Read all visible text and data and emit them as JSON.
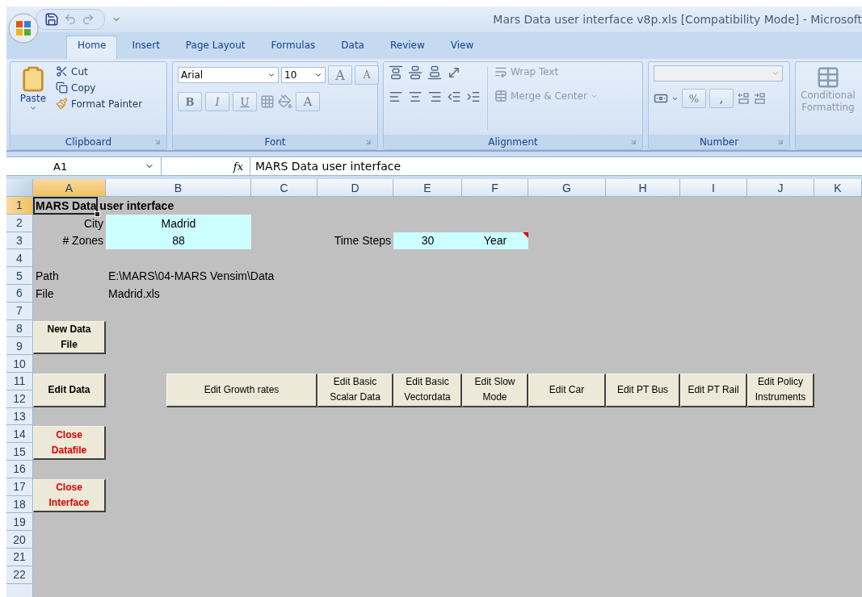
{
  "window": {
    "title": "Mars Data user interface v8p.xls  [Compatibility Mode] - Microsoft"
  },
  "ribbon_tabs": [
    {
      "label": "Home",
      "selected": true
    },
    {
      "label": "Insert",
      "selected": false
    },
    {
      "label": "Page Layout",
      "selected": false
    },
    {
      "label": "Formulas",
      "selected": false
    },
    {
      "label": "Data",
      "selected": false
    },
    {
      "label": "Review",
      "selected": false
    },
    {
      "label": "View",
      "selected": false
    }
  ],
  "clipboard": {
    "title": "Clipboard",
    "paste": "Paste",
    "cut": "Cut",
    "copy": "Copy",
    "format_painter": "Format Painter"
  },
  "font": {
    "title": "Font",
    "font_name": "Arial",
    "font_size": "10",
    "grow": "A",
    "shrink": "A",
    "bold": "B",
    "italic": "I",
    "underline": "U",
    "font_color": "A"
  },
  "alignment": {
    "title": "Alignment",
    "wrap_text": "Wrap Text",
    "merge": "Merge & Center"
  },
  "number": {
    "title": "Number",
    "percent": "%",
    "comma": ","
  },
  "styles": {
    "conditional": "Conditional",
    "formatting": "Formatting"
  },
  "formula_bar": {
    "name_box": "A1",
    "function_label": "fx",
    "content": "MARS Data user interface"
  },
  "sheet": {
    "columns": [
      {
        "label": "A",
        "selected": true
      },
      {
        "label": "B",
        "selected": false
      },
      {
        "label": "C",
        "selected": false
      },
      {
        "label": "D",
        "selected": false
      },
      {
        "label": "E",
        "selected": false
      },
      {
        "label": "F",
        "selected": false
      },
      {
        "label": "G",
        "selected": false
      },
      {
        "label": "H",
        "selected": false
      },
      {
        "label": "I",
        "selected": false
      },
      {
        "label": "J",
        "selected": false
      },
      {
        "label": "K",
        "selected": false
      }
    ],
    "rows": [
      {
        "label": "1",
        "selected": true
      },
      {
        "label": "2",
        "selected": false
      },
      {
        "label": "3",
        "selected": false
      },
      {
        "label": "4",
        "selected": false
      },
      {
        "label": "5",
        "selected": false
      },
      {
        "label": "6",
        "selected": false
      },
      {
        "label": "7",
        "selected": false
      },
      {
        "label": "8",
        "selected": false
      },
      {
        "label": "9",
        "selected": false
      },
      {
        "label": "10",
        "selected": false
      },
      {
        "label": "11",
        "selected": false
      },
      {
        "label": "12",
        "selected": false
      },
      {
        "label": "13",
        "selected": false
      },
      {
        "label": "14",
        "selected": false
      },
      {
        "label": "15",
        "selected": false
      },
      {
        "label": "16",
        "selected": false
      },
      {
        "label": "17",
        "selected": false
      },
      {
        "label": "18",
        "selected": false
      },
      {
        "label": "19",
        "selected": false
      },
      {
        "label": "20",
        "selected": false
      },
      {
        "label": "21",
        "selected": false
      },
      {
        "label": "22",
        "selected": false
      }
    ],
    "cells": [
      {
        "text": "MARS Data user interface",
        "bold": true,
        "highlighted": false,
        "comment": false,
        "selected": true
      },
      {
        "text": "City",
        "bold": false,
        "highlighted": false,
        "comment": false
      },
      {
        "text": "Madrid",
        "bold": false,
        "highlighted": true,
        "comment": false
      },
      {
        "text": "# Zones",
        "bold": false,
        "highlighted": false,
        "comment": false
      },
      {
        "text": "88",
        "bold": false,
        "highlighted": true,
        "comment": false
      },
      {
        "text": "Time Steps",
        "bold": false,
        "highlighted": false,
        "comment": false
      },
      {
        "text": "30",
        "bold": false,
        "highlighted": true,
        "comment": false
      },
      {
        "text": "Year",
        "bold": false,
        "highlighted": true,
        "comment": true
      },
      {
        "text": "Path",
        "bold": false,
        "highlighted": false,
        "comment": false
      },
      {
        "text": "E:\\MARS\\04-MARS Vensim\\Data",
        "bold": false,
        "highlighted": false,
        "comment": false
      },
      {
        "text": "File",
        "bold": false,
        "highlighted": false,
        "comment": false
      },
      {
        "text": "Madrid.xls",
        "bold": false,
        "highlighted": false,
        "comment": false
      }
    ],
    "side_buttons": [
      {
        "label": "New Data\nFile",
        "color": "#000000"
      },
      {
        "label": "Edit Data",
        "color": "#000000"
      },
      {
        "label": "Close\nDatafile",
        "color": "#e00000"
      },
      {
        "label": "Close\nInterface",
        "color": "#e00000"
      }
    ],
    "edit_buttons": [
      {
        "label": "Edit Growth rates"
      },
      {
        "label": "Edit Basic\nScalar Data"
      },
      {
        "label": "Edit Basic\nVectordata"
      },
      {
        "label": "Edit Slow\nMode"
      },
      {
        "label": "Edit Car"
      },
      {
        "label": "Edit PT Bus"
      },
      {
        "label": "Edit PT Rail"
      },
      {
        "label": "Edit Policy\nInstruments"
      }
    ]
  }
}
